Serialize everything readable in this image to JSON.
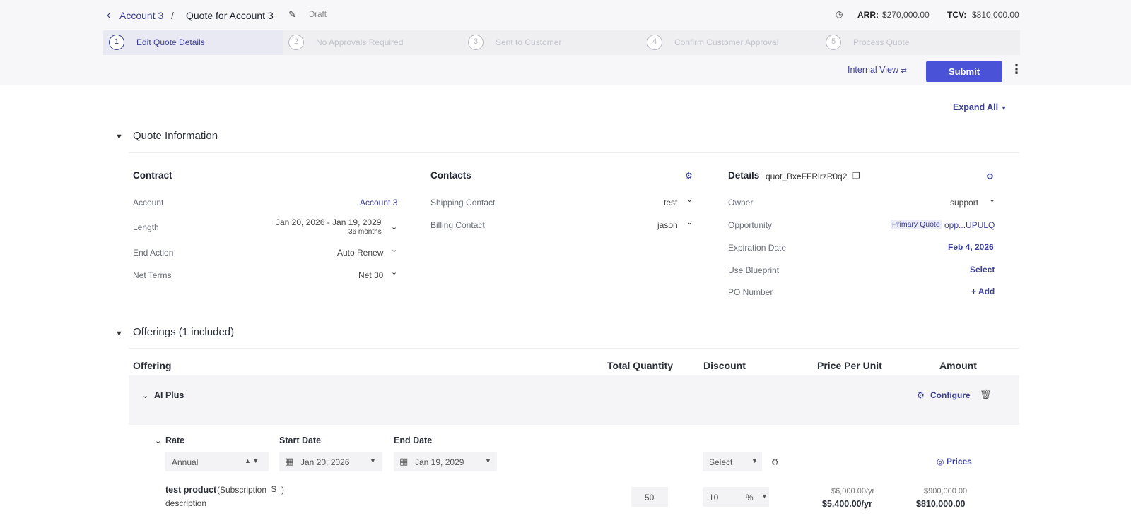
{
  "header": {
    "back_icon": "chevron-left-icon",
    "account_link": "Account 3",
    "separator": "/",
    "title": "Quote for Account 3",
    "status": "Draft",
    "arr_label": "ARR:",
    "arr_value": "$270,000.00",
    "tcv_label": "TCV:",
    "tcv_value": "$810,000.00"
  },
  "stepper": [
    {
      "num": "1",
      "label": "Edit Quote Details",
      "active": true
    },
    {
      "num": "2",
      "label": "No Approvals Required",
      "active": false
    },
    {
      "num": "3",
      "label": "Sent to Customer",
      "active": false
    },
    {
      "num": "4",
      "label": "Confirm Customer Approval",
      "active": false
    },
    {
      "num": "5",
      "label": "Process Quote",
      "active": false
    }
  ],
  "actions": {
    "internal_view": "Internal View",
    "submit": "Submit",
    "expand_all": "Expand All"
  },
  "quote_info": {
    "title": "Quote Information",
    "contract": {
      "heading": "Contract",
      "account_label": "Account",
      "account_value": "Account 3",
      "length_label": "Length",
      "length_value": "Jan 20, 2026 - Jan 19, 2029",
      "length_sub": "36 months",
      "end_action_label": "End Action",
      "end_action_value": "Auto Renew",
      "net_terms_label": "Net Terms",
      "net_terms_value": "Net 30"
    },
    "contacts": {
      "heading": "Contacts",
      "shipping_label": "Shipping Contact",
      "shipping_value": "test",
      "billing_label": "Billing Contact",
      "billing_value": "jason"
    },
    "details": {
      "heading": "Details",
      "quote_id": "quot_BxeFFRlrzR0q2",
      "owner_label": "Owner",
      "owner_value": "support",
      "opportunity_label": "Opportunity",
      "opportunity_tag": "Primary Quote",
      "opportunity_value": "opp...UPULQ",
      "expiration_label": "Expiration Date",
      "expiration_value": "Feb 4, 2026",
      "blueprint_label": "Use Blueprint",
      "blueprint_value": "Select",
      "po_label": "PO Number",
      "po_value": "+ Add"
    }
  },
  "offerings": {
    "title": "Offerings (1 included)",
    "columns": [
      "Offering",
      "Total Quantity",
      "Discount",
      "Price Per Unit",
      "Amount"
    ],
    "offering_name": "AI Plus",
    "configure": "Configure",
    "rate_label": "Rate",
    "start_label": "Start Date",
    "end_label": "End Date",
    "rate_value": "Annual",
    "start_value": "Jan 20, 2026",
    "end_value": "Jan 19, 2029",
    "discount_select": "Select",
    "prices_link": "Prices",
    "product_name": "test product",
    "product_type": "(Subscription",
    "product_type_close": ")",
    "product_desc": "description",
    "quantity": "50",
    "discount_value": "10",
    "discount_unit": "%",
    "ppu_original": "$6,000.00/yr",
    "ppu_final": "$5,400.00/yr",
    "amount_original": "$900,000.00",
    "amount_final": "$810,000.00"
  }
}
